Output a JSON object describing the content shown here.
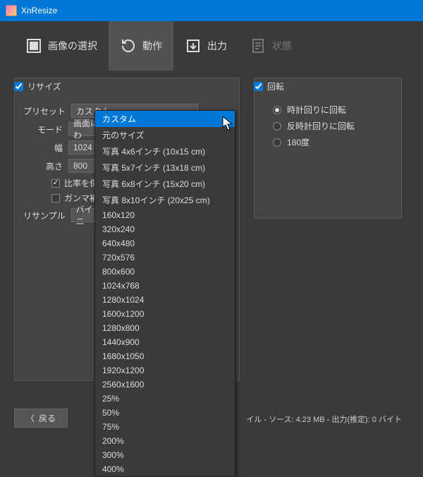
{
  "window": {
    "title": "XnResize"
  },
  "tabs": {
    "select": "画像の選択",
    "action": "動作",
    "output": "出力",
    "status": "状態"
  },
  "resize": {
    "title": "リサイズ",
    "preset_label": "プリセット",
    "preset_value": "カスタム",
    "mode_label": "モード",
    "mode_value": "画面に合わ",
    "width_label": "幅",
    "width_value": "1024",
    "height_label": "高さ",
    "height_value": "800",
    "keep_ratio": "比率を保つ",
    "gamma": "ガンマ補正を使",
    "resample_label": "リサンプル",
    "resample_value": "バイリニ"
  },
  "rotate": {
    "title": "回転",
    "cw": "時計回りに回転",
    "ccw": "反時計回りに回転",
    "deg180": "180度"
  },
  "presets": [
    "カスタム",
    "元のサイズ",
    "写真 4x6インチ (10x15 cm)",
    "写真 5x7インチ (13x18 cm)",
    "写真 6x8インチ (15x20 cm)",
    "写真 8x10インチ (20x25 cm)",
    "160x120",
    "320x240",
    "640x480",
    "720x576",
    "800x600",
    "1024x768",
    "1280x1024",
    "1600x1200",
    "1280x800",
    "1440x900",
    "1680x1050",
    "1920x1200",
    "2560x1600",
    "25%",
    "50%",
    "75%",
    "200%",
    "300%",
    "400%"
  ],
  "footer": {
    "back": "戻る",
    "status": "イル - ソース: 4.23 MB - 出力(推定): 0 バイト"
  }
}
